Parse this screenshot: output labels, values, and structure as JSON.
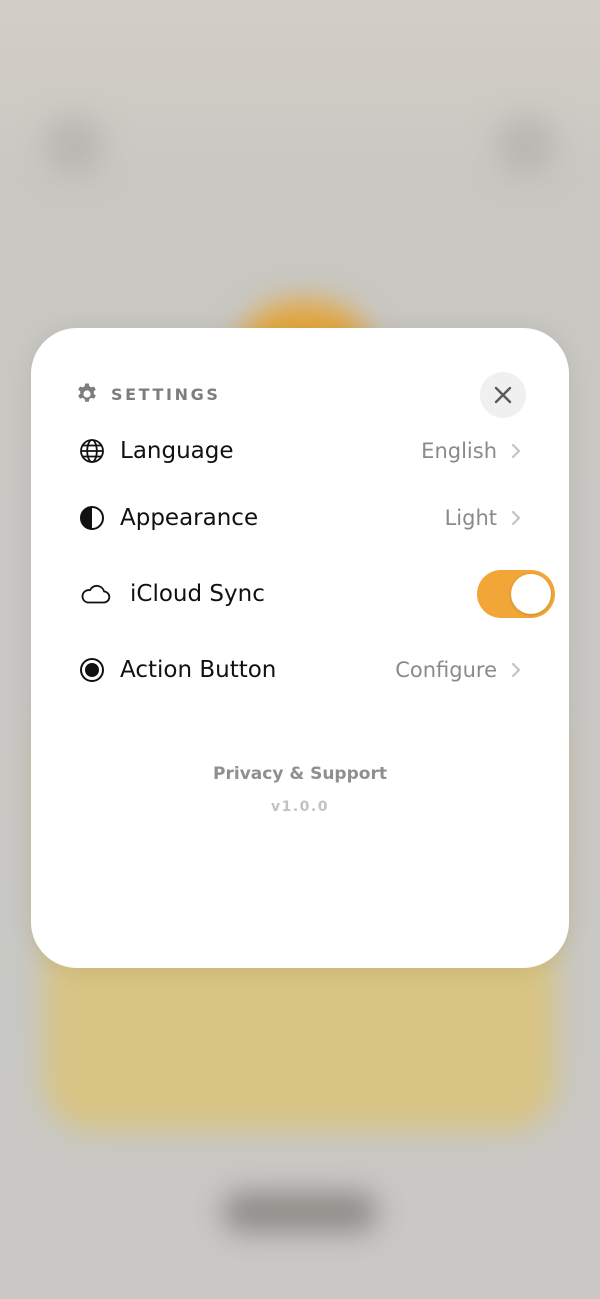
{
  "settings": {
    "title": "SETTINGS",
    "header_icon": "gear-icon",
    "close_icon": "close-icon",
    "rows": [
      {
        "label": "Language",
        "value": "English",
        "icon": "globe-icon"
      },
      {
        "label": "Appearance",
        "value": "Light",
        "icon": "half-circle-icon"
      },
      {
        "label": "iCloud Sync",
        "icon": "cloud-icon",
        "toggle_on": true
      },
      {
        "label": "Action Button",
        "value": "Configure",
        "icon": "filled-circle-icon"
      }
    ],
    "footer_link": "Privacy & Support",
    "version": "v1.0.0"
  },
  "colors": {
    "accent": "#f2a638",
    "sheet_background": "#ffffff",
    "value_text": "#8a8a8a",
    "backdrop": "#c8c7c3"
  }
}
